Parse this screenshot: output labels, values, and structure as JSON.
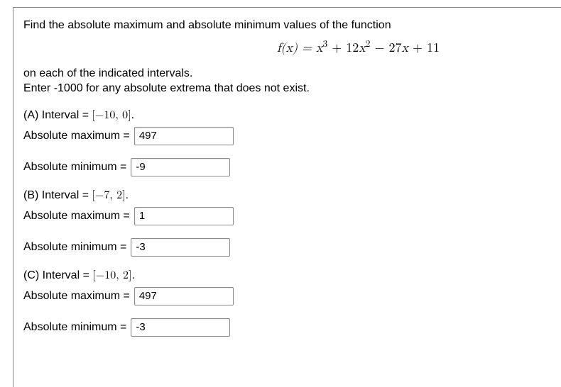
{
  "question": {
    "intro": "Find the absolute maximum and absolute minimum values of the function",
    "on_intervals": "on each of the indicated intervals.",
    "instruction": "Enter -1000 for any absolute extrema that does not exist."
  },
  "equation": {
    "lhs": "f(x) = ",
    "term1": "x",
    "exp1": "3",
    "plus1": " + 12",
    "term2": "x",
    "exp2": "2",
    "minus": " − 27",
    "term3": "x",
    "plus2": " + 11"
  },
  "parts": {
    "A": {
      "label": "(A) Interval = ",
      "interval": "[−10, 0]",
      "dot": ".",
      "max_label": "Absolute maximum = ",
      "max_value": "497",
      "min_label": "Absolute minimum = ",
      "min_value": "-9"
    },
    "B": {
      "label": "(B) Interval = ",
      "interval": "[−7, 2]",
      "dot": ".",
      "max_label": "Absolute maximum = ",
      "max_value": "1",
      "min_label": "Absolute minimum = ",
      "min_value": "-3"
    },
    "C": {
      "label": "(C) Interval = ",
      "interval": "[−10, 2]",
      "dot": ".",
      "max_label": "Absolute maximum = ",
      "max_value": "497",
      "min_label": "Absolute minimum = ",
      "min_value": "-3"
    }
  },
  "chart_data": {
    "type": "table",
    "function": "f(x) = x^3 + 12x^2 - 27x + 11",
    "notes": "Enter -1000 for any absolute extrema that does not exist.",
    "rows": [
      {
        "part": "A",
        "interval": "[-10, 0]",
        "absolute_maximum": 497,
        "absolute_minimum": -9
      },
      {
        "part": "B",
        "interval": "[-7, 2]",
        "absolute_maximum": 1,
        "absolute_minimum": -3
      },
      {
        "part": "C",
        "interval": "[-10, 2]",
        "absolute_maximum": 497,
        "absolute_minimum": -3
      }
    ]
  }
}
